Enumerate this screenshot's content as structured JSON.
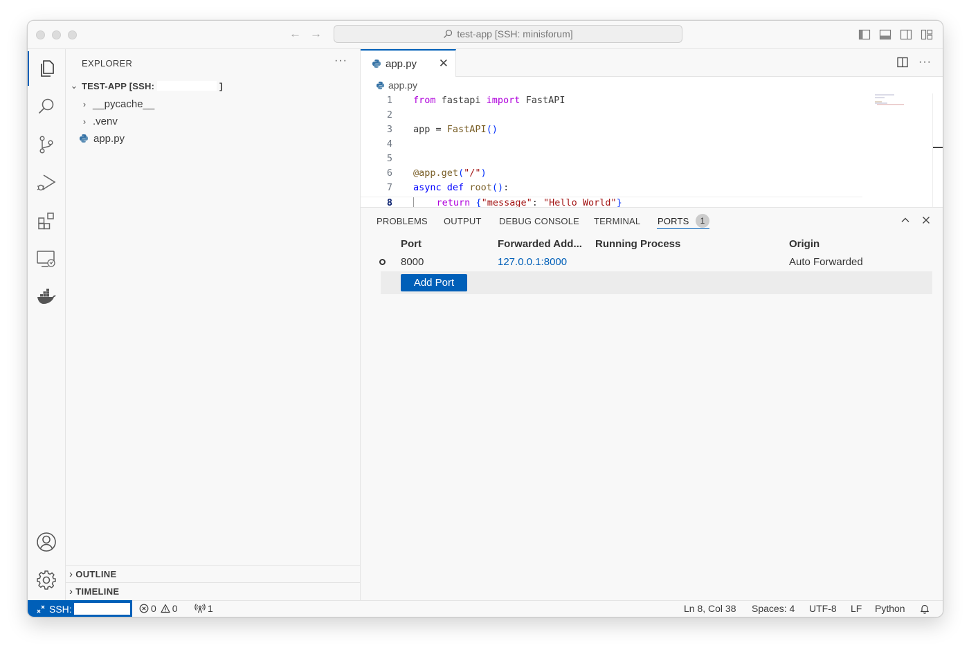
{
  "window": {
    "command_center": "test-app [SSH: minisforum]"
  },
  "sidebar": {
    "header": "EXPLORER",
    "more": "···",
    "root_label_prefix": "TEST-APP [SSH:",
    "root_label_suffix": "]",
    "items": [
      {
        "label": "__pycache__",
        "type": "folder"
      },
      {
        "label": ".venv",
        "type": "folder"
      },
      {
        "label": "app.py",
        "type": "python-file"
      }
    ],
    "sections": [
      "OUTLINE",
      "TIMELINE"
    ]
  },
  "editor": {
    "tab_label": "app.py",
    "breadcrumb": "app.py",
    "line_numbers": [
      "1",
      "2",
      "3",
      "4",
      "5",
      "6",
      "7",
      "8"
    ],
    "current_line": 8
  },
  "panel": {
    "tabs": [
      "PROBLEMS",
      "OUTPUT",
      "DEBUG CONSOLE",
      "TERMINAL",
      "PORTS"
    ],
    "active_tab": "PORTS",
    "ports_badge": "1",
    "columns": [
      "Port",
      "Forwarded Add...",
      "Running Process",
      "Origin"
    ],
    "rows": [
      {
        "port": "8000",
        "forwarded": "127.0.0.1:8000",
        "process": "",
        "origin": "Auto Forwarded"
      }
    ],
    "add_port_label": "Add Port"
  },
  "statusbar": {
    "remote_label": "SSH:",
    "errors": "0",
    "warnings": "0",
    "ports": "1",
    "position": "Ln 8, Col 38",
    "spaces": "Spaces: 4",
    "encoding": "UTF-8",
    "eol": "LF",
    "language": "Python"
  },
  "colors": {
    "accent": "#005fb8",
    "keyword_purple": "#af00db",
    "keyword_blue": "#0000ff",
    "string": "#a31515",
    "function": "#795e26"
  }
}
